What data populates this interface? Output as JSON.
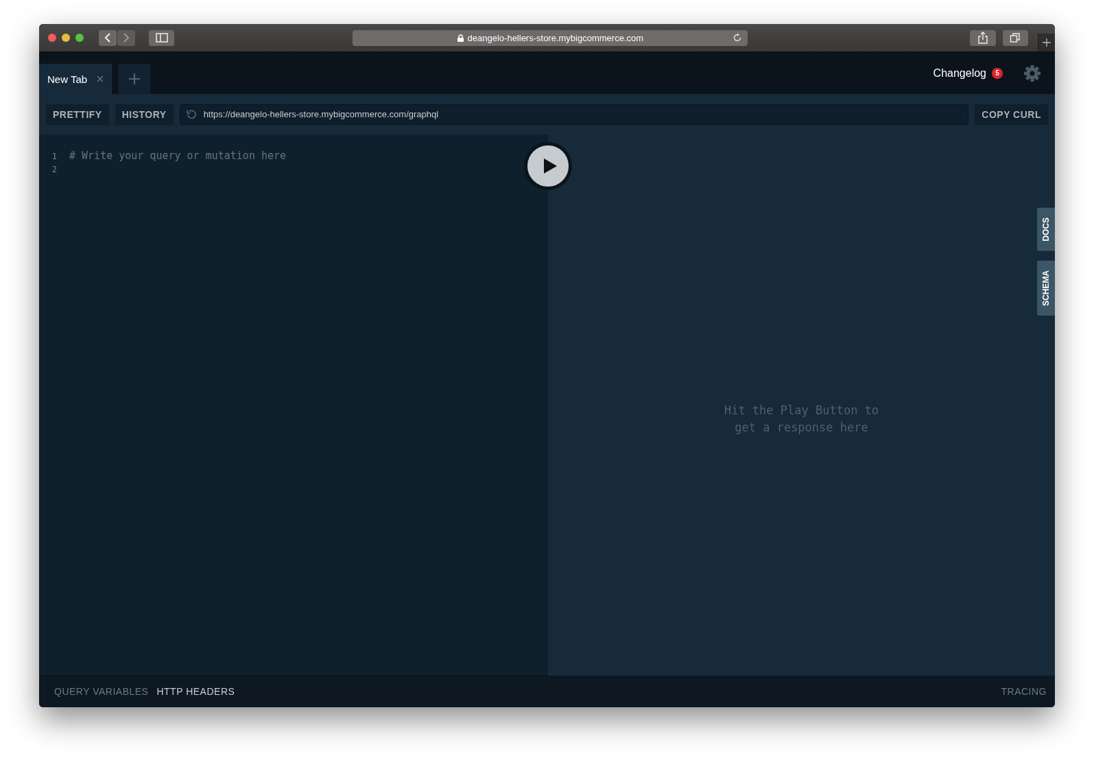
{
  "browser": {
    "address": "deangelo-hellers-store.mybigcommerce.com"
  },
  "tabs": [
    {
      "label": "New Tab",
      "selected": true
    }
  ],
  "header": {
    "changelog": "Changelog",
    "changelog_count": "5"
  },
  "toolbar": {
    "buttons": [
      "PRETTIFY",
      "HISTORY"
    ],
    "endpoint": "https://deangelo-hellers-store.mybigcommerce.com/graphql",
    "copy_button": "COPY CURL"
  },
  "editor": {
    "lines": [
      {
        "number": "1",
        "text": "# Write your query or mutation here"
      },
      {
        "number": "2"
      }
    ]
  },
  "result": {
    "placeholder_lines": [
      "Hit the Play Button to",
      "get a response here"
    ]
  },
  "side_tabs": [
    "DOCS",
    "SCHEMA"
  ],
  "bottom_tabs": [
    {
      "label": "QUERY VARIABLES",
      "selected": false
    },
    {
      "label": "HTTP HEADERS",
      "selected": true
    }
  ],
  "tracing": "TRACING"
}
